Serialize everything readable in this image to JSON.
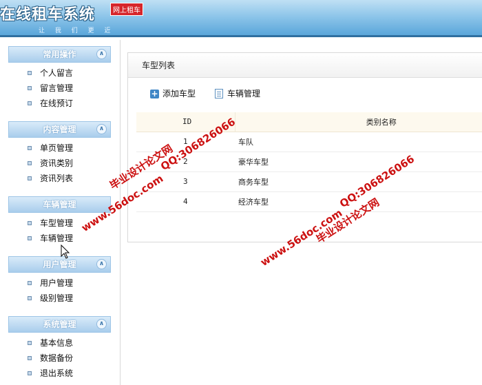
{
  "header": {
    "logo": "在线租车系统",
    "slogan": "让 我 们 更 近",
    "badge": "网上租车",
    "colors": {
      "accent": "#5aa6da",
      "dark": "#2f6f9f"
    }
  },
  "sidebar": {
    "sections": [
      {
        "title": "常用操作",
        "items": [
          "个人留言",
          "留言管理",
          "在线预订"
        ]
      },
      {
        "title": "内容管理",
        "items": [
          "单页管理",
          "资讯类别",
          "资讯列表"
        ]
      },
      {
        "title": "车辆管理",
        "items": [
          "车型管理",
          "车辆管理"
        ]
      },
      {
        "title": "用户管理",
        "items": [
          "用户管理",
          "级别管理"
        ]
      },
      {
        "title": "系统管理",
        "items": [
          "基本信息",
          "数据备份",
          "退出系统"
        ]
      }
    ]
  },
  "main": {
    "panel_title": "车型列表",
    "toolbar": {
      "add_label": "添加车型",
      "vehicle_label": "车辆管理"
    },
    "table": {
      "columns": [
        "ID",
        "类别名称"
      ],
      "rows": [
        {
          "id": "1",
          "name": "车队"
        },
        {
          "id": "2",
          "name": "豪华车型"
        },
        {
          "id": "3",
          "name": "商务车型"
        },
        {
          "id": "4",
          "name": "经济车型"
        }
      ]
    }
  },
  "watermarks": {
    "site": "www.56doc.com",
    "qq": "QQ:306826066",
    "brand": "毕业设计论文网",
    "color": "#cc1111"
  }
}
